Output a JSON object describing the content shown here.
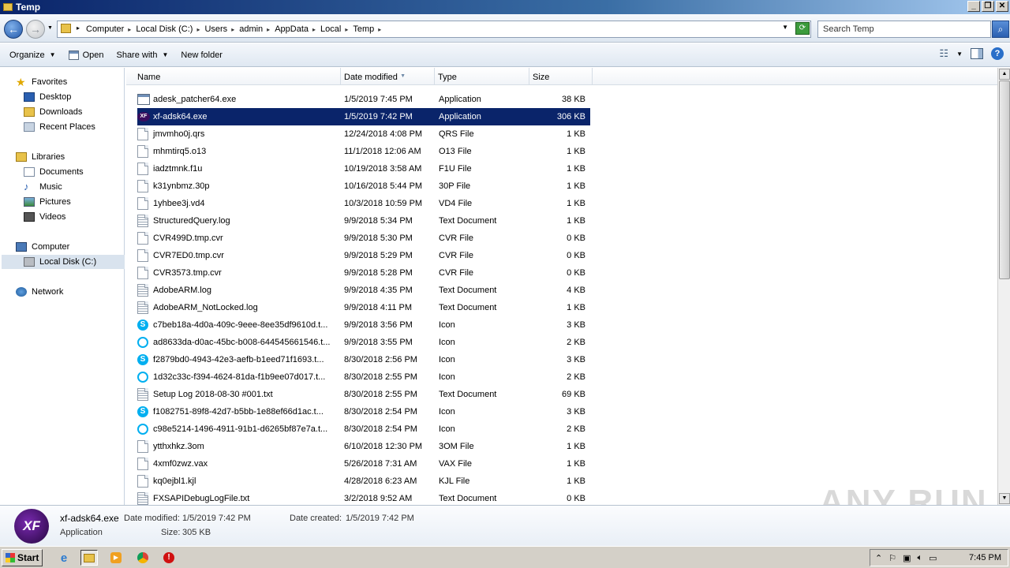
{
  "window": {
    "title": "Temp"
  },
  "address": {
    "crumbs": [
      "Computer",
      "Local Disk (C:)",
      "Users",
      "admin",
      "AppData",
      "Local",
      "Temp"
    ],
    "search_placeholder": "Search Temp"
  },
  "toolbar": {
    "organize": "Organize",
    "open": "Open",
    "share_with": "Share with",
    "new_folder": "New folder"
  },
  "nav": {
    "favorites": "Favorites",
    "desktop": "Desktop",
    "downloads": "Downloads",
    "recent_places": "Recent Places",
    "libraries": "Libraries",
    "documents": "Documents",
    "music": "Music",
    "pictures": "Pictures",
    "videos": "Videos",
    "computer": "Computer",
    "local_disk": "Local Disk (C:)",
    "network": "Network"
  },
  "columns": {
    "name": "Name",
    "date": "Date modified",
    "type": "Type",
    "size": "Size"
  },
  "files": [
    {
      "name": "adesk_patcher64.exe",
      "date": "1/5/2019 7:45 PM",
      "type": "Application",
      "size": "38 KB",
      "icon": "app-icon"
    },
    {
      "name": "xf-adsk64.exe",
      "date": "1/5/2019 7:42 PM",
      "type": "Application",
      "size": "306 KB",
      "icon": "xf-icon"
    },
    {
      "name": "jmvmho0j.qrs",
      "date": "12/24/2018 4:08 PM",
      "type": "QRS File",
      "size": "1 KB",
      "icon": "doc-icon"
    },
    {
      "name": "mhmtirq5.o13",
      "date": "11/1/2018 12:06 AM",
      "type": "O13 File",
      "size": "1 KB",
      "icon": "doc-icon"
    },
    {
      "name": "iadztmnk.f1u",
      "date": "10/19/2018 3:58 AM",
      "type": "F1U File",
      "size": "1 KB",
      "icon": "doc-icon"
    },
    {
      "name": "k31ynbmz.30p",
      "date": "10/16/2018 5:44 PM",
      "type": "30P File",
      "size": "1 KB",
      "icon": "doc-icon"
    },
    {
      "name": "1yhbee3j.vd4",
      "date": "10/3/2018 10:59 PM",
      "type": "VD4 File",
      "size": "1 KB",
      "icon": "doc-icon"
    },
    {
      "name": "StructuredQuery.log",
      "date": "9/9/2018 5:34 PM",
      "type": "Text Document",
      "size": "1 KB",
      "icon": "text-icon"
    },
    {
      "name": "CVR499D.tmp.cvr",
      "date": "9/9/2018 5:30 PM",
      "type": "CVR File",
      "size": "0 KB",
      "icon": "doc-icon"
    },
    {
      "name": "CVR7ED0.tmp.cvr",
      "date": "9/9/2018 5:29 PM",
      "type": "CVR File",
      "size": "0 KB",
      "icon": "doc-icon"
    },
    {
      "name": "CVR3573.tmp.cvr",
      "date": "9/9/2018 5:28 PM",
      "type": "CVR File",
      "size": "0 KB",
      "icon": "doc-icon"
    },
    {
      "name": "AdobeARM.log",
      "date": "9/9/2018 4:35 PM",
      "type": "Text Document",
      "size": "4 KB",
      "icon": "text-icon"
    },
    {
      "name": "AdobeARM_NotLocked.log",
      "date": "9/9/2018 4:11 PM",
      "type": "Text Document",
      "size": "1 KB",
      "icon": "text-icon"
    },
    {
      "name": "c7beb18a-4d0a-409c-9eee-8ee35df9610d.t...",
      "date": "9/9/2018 3:56 PM",
      "type": "Icon",
      "size": "3 KB",
      "icon": "skype-icon"
    },
    {
      "name": "ad8633da-d0ac-45bc-b008-644545661546.t...",
      "date": "9/9/2018 3:55 PM",
      "type": "Icon",
      "size": "2 KB",
      "icon": "skype-outline-icon"
    },
    {
      "name": "f2879bd0-4943-42e3-aefb-b1eed71f1693.t...",
      "date": "8/30/2018 2:56 PM",
      "type": "Icon",
      "size": "3 KB",
      "icon": "skype-icon"
    },
    {
      "name": "1d32c33c-f394-4624-81da-f1b9ee07d017.t...",
      "date": "8/30/2018 2:55 PM",
      "type": "Icon",
      "size": "2 KB",
      "icon": "skype-outline-icon"
    },
    {
      "name": "Setup Log 2018-08-30 #001.txt",
      "date": "8/30/2018 2:55 PM",
      "type": "Text Document",
      "size": "69 KB",
      "icon": "text-icon"
    },
    {
      "name": "f1082751-89f8-42d7-b5bb-1e88ef66d1ac.t...",
      "date": "8/30/2018 2:54 PM",
      "type": "Icon",
      "size": "3 KB",
      "icon": "skype-icon"
    },
    {
      "name": "c98e5214-1496-4911-91b1-d6265bf87e7a.t...",
      "date": "8/30/2018 2:54 PM",
      "type": "Icon",
      "size": "2 KB",
      "icon": "skype-outline-icon"
    },
    {
      "name": "ytthxhkz.3om",
      "date": "6/10/2018 12:30 PM",
      "type": "3OM File",
      "size": "1 KB",
      "icon": "doc-icon"
    },
    {
      "name": "4xmf0zwz.vax",
      "date": "5/26/2018 7:31 AM",
      "type": "VAX File",
      "size": "1 KB",
      "icon": "doc-icon"
    },
    {
      "name": "kq0ejbl1.kjl",
      "date": "4/28/2018 6:23 AM",
      "type": "KJL File",
      "size": "1 KB",
      "icon": "doc-icon"
    },
    {
      "name": "FXSAPIDebugLogFile.txt",
      "date": "3/2/2018 9:52 AM",
      "type": "Text Document",
      "size": "0 KB",
      "icon": "text-icon"
    }
  ],
  "selected_index": 1,
  "details": {
    "icon_text": "XF",
    "filename": "xf-adsk64.exe",
    "filetype": "Application",
    "date_modified_label": "Date modified:",
    "date_modified": "1/5/2019 7:42 PM",
    "date_created_label": "Date created:",
    "date_created": "1/5/2019 7:42 PM",
    "size_label": "Size:",
    "size": "305 KB"
  },
  "watermark": "ANY RUN",
  "taskbar": {
    "start": "Start",
    "clock": "7:45 PM"
  },
  "colors": {
    "selection": "#0a246a",
    "titlebar": "#0a246a",
    "accent": "#3a6ea5"
  }
}
